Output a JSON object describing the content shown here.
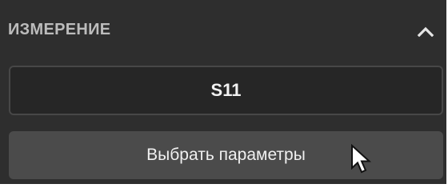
{
  "section": {
    "title": "ИЗМЕРЕНИЕ",
    "collapse_icon": "chevron-up-icon"
  },
  "measurement": {
    "value": "S11"
  },
  "actions": {
    "select_params_label": "Выбрать параметры"
  },
  "pointer": {
    "icon": "mouse-cursor-icon"
  },
  "colors": {
    "panel_bg": "#2e2e2e",
    "header_text": "#bcbcbc",
    "value_box_bg": "#262626",
    "value_box_border": "#474747",
    "button_bg": "#4b4b4b",
    "text_primary": "#f2f2f2"
  }
}
